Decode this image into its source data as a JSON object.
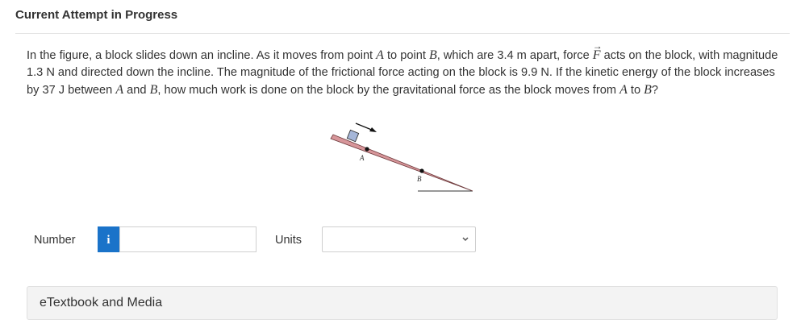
{
  "header": {
    "title": "Current Attempt in Progress"
  },
  "question": {
    "part1": "In the figure, a block slides down an incline. As it moves from point ",
    "A1": "A",
    "part2": " to point ",
    "B1": "B",
    "part3": ", which are 3.4 m apart, force ",
    "F": "F",
    "part4": " acts on the block, with magnitude 1.3 N and directed down the incline. The magnitude of the frictional force acting on the block is 9.9 N. If the kinetic energy of the block increases by 37 J between ",
    "A2": "A",
    "part5": " and ",
    "B2": "B",
    "part6": ", how much work is done on the block by the gravitational force as the block moves from ",
    "A3": "A",
    "part7": " to ",
    "B3": "B",
    "part8": "?"
  },
  "figure": {
    "label_a": "A",
    "label_b": "B"
  },
  "answer": {
    "number_label": "Number",
    "info_icon": "i",
    "number_value": "",
    "units_label": "Units",
    "units_value": ""
  },
  "etextbook": {
    "label": "eTextbook and Media"
  }
}
